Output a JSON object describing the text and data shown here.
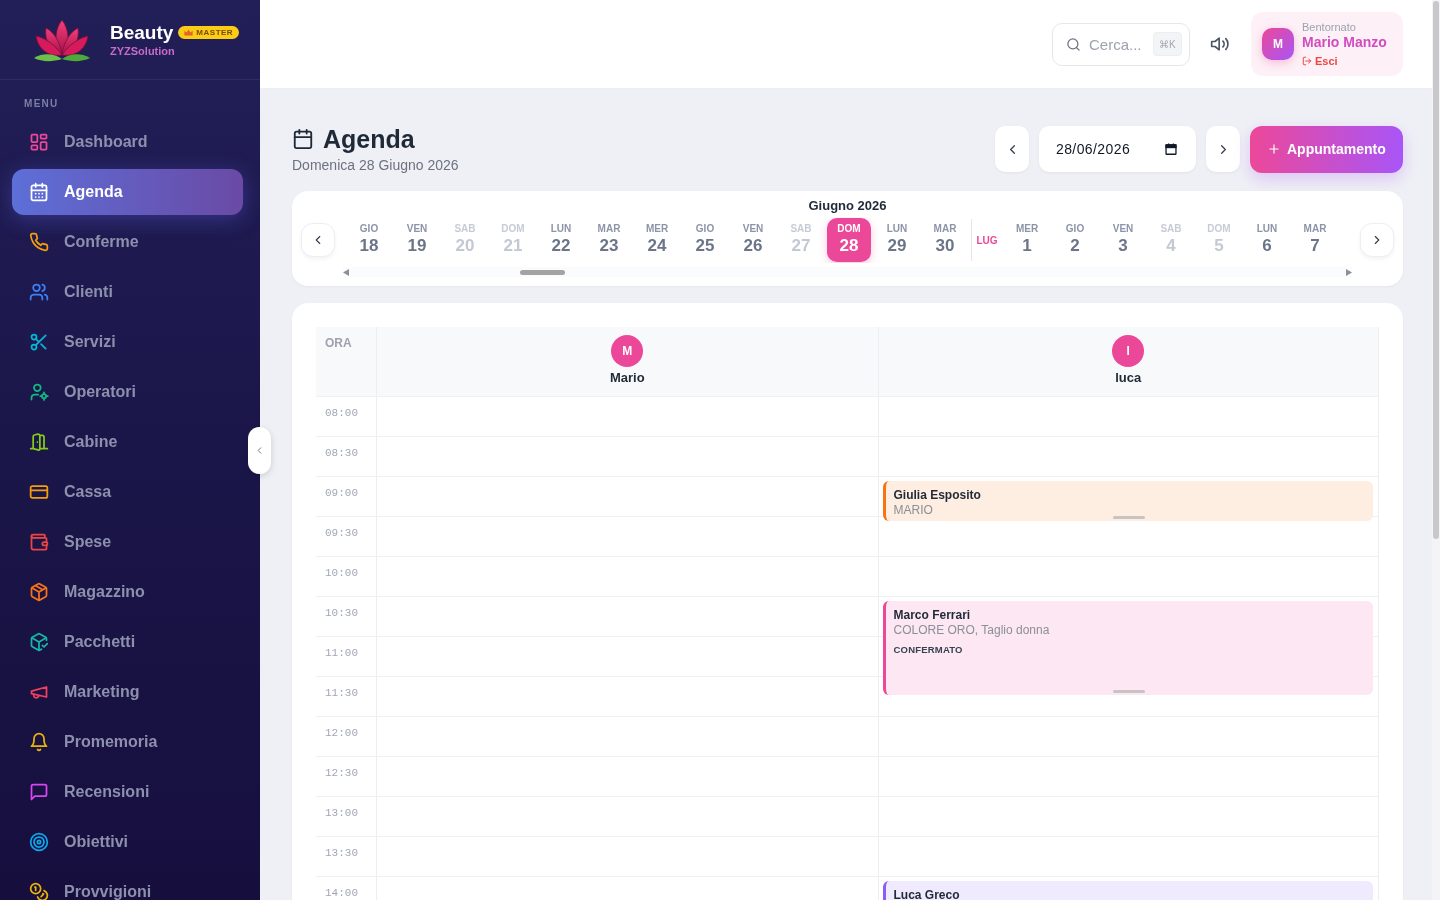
{
  "sidebar": {
    "brand": {
      "name": "Beauty",
      "badge": "MASTER",
      "company": "ZYZSolution"
    },
    "section_label": "MENU",
    "items": [
      {
        "label": "Dashboard",
        "selected": false,
        "color": "#ec4899"
      },
      {
        "label": "Agenda",
        "selected": true
      },
      {
        "label": "Conferme",
        "selected": false,
        "color": "#f59e0b"
      },
      {
        "label": "Clienti",
        "selected": false,
        "color": "#3b82f6"
      },
      {
        "label": "Servizi",
        "selected": false,
        "color": "#06b6d4"
      },
      {
        "label": "Operatori",
        "selected": false,
        "color": "#10b981"
      },
      {
        "label": "Cabine",
        "selected": false,
        "color": "#84cc16"
      },
      {
        "label": "Cassa",
        "selected": false,
        "color": "#f59e0b"
      },
      {
        "label": "Spese",
        "selected": false,
        "color": "#ef4444"
      },
      {
        "label": "Magazzino",
        "selected": false,
        "color": "#f97316"
      },
      {
        "label": "Pacchetti",
        "selected": false,
        "color": "#14b8a6"
      },
      {
        "label": "Marketing",
        "selected": false,
        "color": "#f43f5e"
      },
      {
        "label": "Promemoria",
        "selected": false,
        "color": "#eab308"
      },
      {
        "label": "Recensioni",
        "selected": false,
        "color": "#d946ef"
      },
      {
        "label": "Obiettivi",
        "selected": false,
        "color": "#0ea5e9"
      },
      {
        "label": "Provvigioni",
        "selected": false,
        "color": "#eab308"
      }
    ]
  },
  "top_bar": {
    "search": {
      "placeholder": "Cerca...",
      "shortcut": "⌘K"
    },
    "user": {
      "greeting": "Bentornato",
      "initial": "M",
      "name": "Mario Manzo",
      "logout": "Esci"
    }
  },
  "page": {
    "title": "Agenda",
    "subtitle": "Domenica 28 Giugno 2026",
    "date_field": {
      "value": "28/06/2026"
    },
    "add_button": "Appuntamento"
  },
  "date_strip": {
    "month_title": "Giugno 2026",
    "days": [
      {
        "kind": "day",
        "weekday": "GIO",
        "day": "18",
        "weekend": false,
        "selected": false
      },
      {
        "kind": "day",
        "weekday": "VEN",
        "day": "19",
        "weekend": false,
        "selected": false
      },
      {
        "kind": "day",
        "weekday": "SAB",
        "day": "20",
        "weekend": true,
        "selected": false
      },
      {
        "kind": "day",
        "weekday": "DOM",
        "day": "21",
        "weekend": true,
        "selected": false
      },
      {
        "kind": "day",
        "weekday": "LUN",
        "day": "22",
        "weekend": false,
        "selected": false
      },
      {
        "kind": "day",
        "weekday": "MAR",
        "day": "23",
        "weekend": false,
        "selected": false
      },
      {
        "kind": "day",
        "weekday": "MER",
        "day": "24",
        "weekend": false,
        "selected": false
      },
      {
        "kind": "day",
        "weekday": "GIO",
        "day": "25",
        "weekend": false,
        "selected": false
      },
      {
        "kind": "day",
        "weekday": "VEN",
        "day": "26",
        "weekend": false,
        "selected": false
      },
      {
        "kind": "day",
        "weekday": "SAB",
        "day": "27",
        "weekend": true,
        "selected": false
      },
      {
        "kind": "day",
        "weekday": "DOM",
        "day": "28",
        "weekend": true,
        "selected": true
      },
      {
        "kind": "day",
        "weekday": "LUN",
        "day": "29",
        "weekend": false,
        "selected": false
      },
      {
        "kind": "day",
        "weekday": "MAR",
        "day": "30",
        "weekend": false,
        "selected": false
      },
      {
        "kind": "month",
        "label": "LUG"
      },
      {
        "kind": "day",
        "weekday": "MER",
        "day": "1",
        "weekend": false,
        "selected": false
      },
      {
        "kind": "day",
        "weekday": "GIO",
        "day": "2",
        "weekend": false,
        "selected": false
      },
      {
        "kind": "day",
        "weekday": "VEN",
        "day": "3",
        "weekend": false,
        "selected": false
      },
      {
        "kind": "day",
        "weekday": "SAB",
        "day": "4",
        "weekend": true,
        "selected": false
      },
      {
        "kind": "day",
        "weekday": "DOM",
        "day": "5",
        "weekend": true,
        "selected": false
      },
      {
        "kind": "day",
        "weekday": "LUN",
        "day": "6",
        "weekend": false,
        "selected": false
      },
      {
        "kind": "day",
        "weekday": "MAR",
        "day": "7",
        "weekend": false,
        "selected": false
      }
    ]
  },
  "schedule": {
    "time_heading": "ORA",
    "slots": [
      "08:00",
      "08:30",
      "09:00",
      "09:30",
      "10:00",
      "10:30",
      "11:00",
      "11:30",
      "12:00",
      "12:30",
      "13:00",
      "13:30",
      "14:00"
    ],
    "operators": [
      {
        "initial": "M",
        "name": "Mario",
        "slots": [
          {
            "kind": "free"
          },
          {
            "kind": "free"
          },
          {
            "kind": "free"
          },
          {
            "kind": "free"
          },
          {
            "kind": "free"
          },
          {
            "kind": "free"
          },
          {
            "kind": "free"
          },
          {
            "kind": "free"
          },
          {
            "kind": "free"
          },
          {
            "kind": "free"
          },
          {
            "kind": "free"
          },
          {
            "kind": "free"
          },
          {
            "kind": "free"
          }
        ]
      },
      {
        "initial": "I",
        "name": "luca",
        "slots": [
          {
            "kind": "free"
          },
          {
            "kind": "free"
          },
          {
            "kind": "booked",
            "client": "Giulia Esposito",
            "details": "MARIO",
            "color": "#f97316"
          },
          {
            "kind": "free"
          },
          {
            "kind": "free"
          },
          {
            "kind": "booked",
            "client": "Marco Ferrari",
            "details": "COLORE ORO, Taglio donna",
            "status": "CONFERMATO",
            "color": "#ec4899"
          },
          {
            "kind": "continued"
          },
          {
            "kind": "half"
          },
          {
            "kind": "free"
          },
          {
            "kind": "free"
          },
          {
            "kind": "free"
          },
          {
            "kind": "free"
          },
          {
            "kind": "booked",
            "client": "Luca Greco",
            "color": "#8b5cf6"
          }
        ]
      }
    ]
  }
}
